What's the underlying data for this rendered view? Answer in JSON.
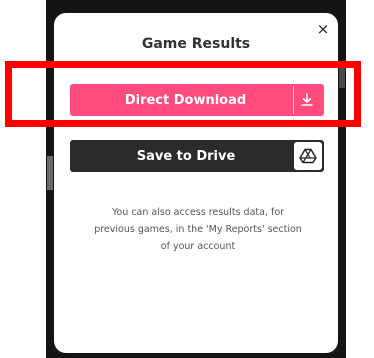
{
  "modal": {
    "title": "Game Results",
    "close_label": "×",
    "buttons": {
      "direct_download_label": "Direct Download",
      "direct_download_icon": "download-icon",
      "save_to_drive_label": "Save to Drive",
      "save_to_drive_icon": "google-drive-icon"
    },
    "info_lines": [
      "You can also access results data, for",
      "previous games, in the 'My Reports' section",
      "of your account"
    ]
  },
  "colors": {
    "download_button": "#ff4b7d",
    "drive_button": "#2b2b2b",
    "highlight_box": "#ff0000"
  }
}
